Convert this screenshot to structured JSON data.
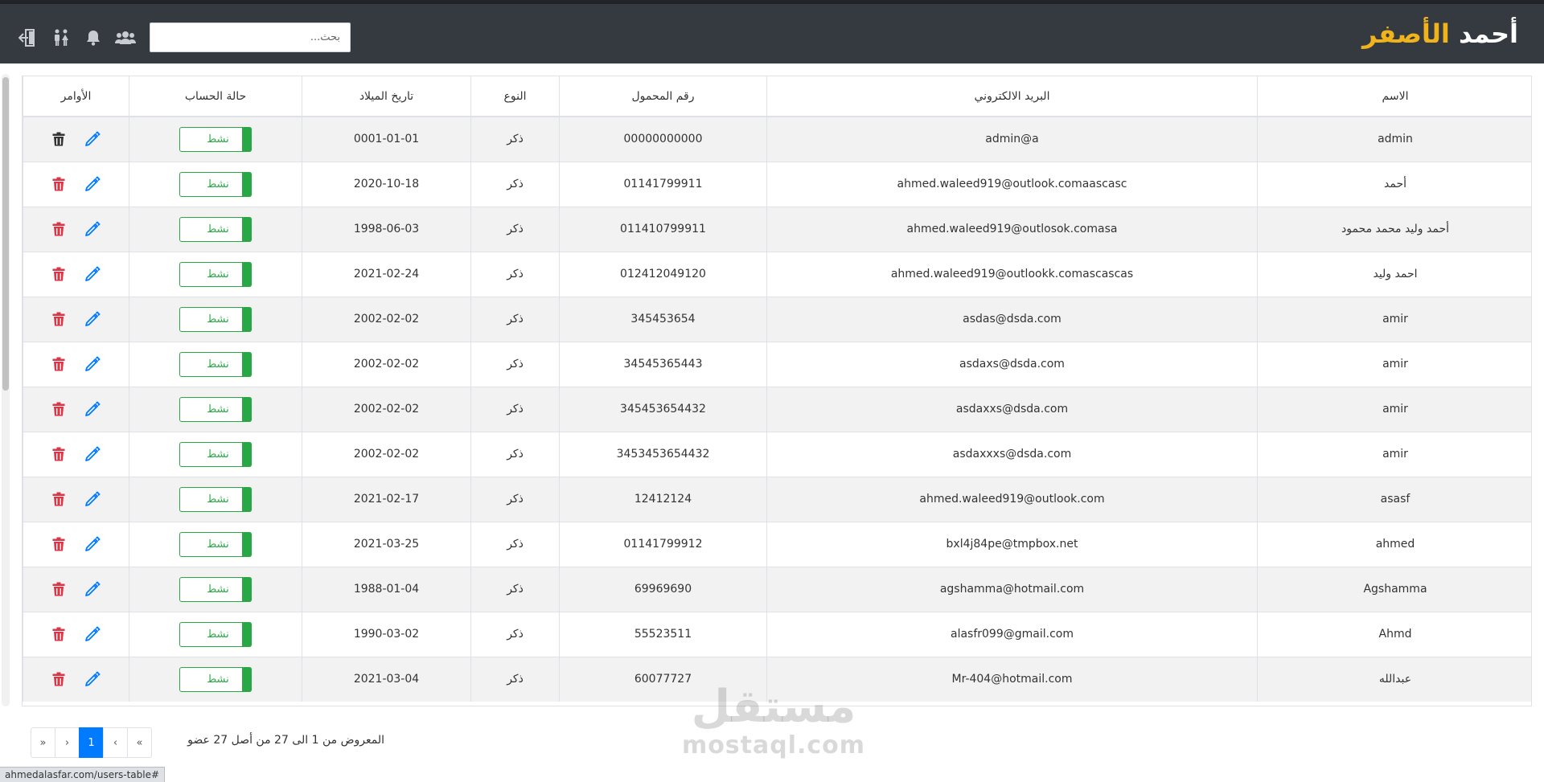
{
  "header": {
    "brand_first": "أحمد",
    "brand_second": "الأصفر",
    "search_placeholder": "بحث...",
    "icons": [
      "logout-icon",
      "gender-icon",
      "bell-icon",
      "users-icon"
    ],
    "colors": {
      "bar": "#343a40",
      "brand_accent": "#f0b31b"
    }
  },
  "table": {
    "columns": [
      "الاسم",
      "البريد الالكتروني",
      "رقم المحمول",
      "النوع",
      "تاريخ الميلاد",
      "حالة الحساب",
      "الأوامر"
    ],
    "rows": [
      {
        "name": "admin",
        "email": "admin@a",
        "mobile": "00000000000",
        "gender": "ذكر",
        "birth": "0001-01-01",
        "status": "نشط",
        "delete_color": "#333333"
      },
      {
        "name": "أحمد",
        "email": "ahmed.waleed919@outlook.comaascasc",
        "mobile": "01141799911",
        "gender": "ذكر",
        "birth": "2020-10-18",
        "status": "نشط",
        "delete_color": "#dc3545"
      },
      {
        "name": "أحمد وليد محمد محمود",
        "email": "ahmed.waleed919@outlosok.comasa",
        "mobile": "011410799911",
        "gender": "ذكر",
        "birth": "1998-06-03",
        "status": "نشط",
        "delete_color": "#dc3545"
      },
      {
        "name": "احمد وليد",
        "email": "ahmed.waleed919@outlookk.comascascas",
        "mobile": "012412049120",
        "gender": "ذكر",
        "birth": "2021-02-24",
        "status": "نشط",
        "delete_color": "#dc3545"
      },
      {
        "name": "amir",
        "email": "asdas@dsda.com",
        "mobile": "345453654",
        "gender": "ذكر",
        "birth": "2002-02-02",
        "status": "نشط",
        "delete_color": "#dc3545"
      },
      {
        "name": "amir",
        "email": "asdaxs@dsda.com",
        "mobile": "34545365443",
        "gender": "ذكر",
        "birth": "2002-02-02",
        "status": "نشط",
        "delete_color": "#dc3545"
      },
      {
        "name": "amir",
        "email": "asdaxxs@dsda.com",
        "mobile": "345453654432",
        "gender": "ذكر",
        "birth": "2002-02-02",
        "status": "نشط",
        "delete_color": "#dc3545"
      },
      {
        "name": "amir",
        "email": "asdaxxxs@dsda.com",
        "mobile": "3453453654432",
        "gender": "ذكر",
        "birth": "2002-02-02",
        "status": "نشط",
        "delete_color": "#dc3545"
      },
      {
        "name": "asasf",
        "email": "ahmed.waleed919@outlook.com",
        "mobile": "12412124",
        "gender": "ذكر",
        "birth": "2021-02-17",
        "status": "نشط",
        "delete_color": "#dc3545"
      },
      {
        "name": "ahmed",
        "email": "bxl4j84pe@tmpbox.net",
        "mobile": "01141799912",
        "gender": "ذكر",
        "birth": "2021-03-25",
        "status": "نشط",
        "delete_color": "#dc3545"
      },
      {
        "name": "Agshamma",
        "email": "agshamma@hotmail.com",
        "mobile": "69969690",
        "gender": "ذكر",
        "birth": "1988-01-04",
        "status": "نشط",
        "delete_color": "#dc3545"
      },
      {
        "name": "Ahmd",
        "email": "alasfr099@gmail.com",
        "mobile": "55523511",
        "gender": "ذكر",
        "birth": "1990-03-02",
        "status": "نشط",
        "delete_color": "#dc3545"
      },
      {
        "name": "عبدالله",
        "email": "Mr-404@hotmail.com",
        "mobile": "60077727",
        "gender": "ذكر",
        "birth": "2021-03-04",
        "status": "نشط",
        "delete_color": "#dc3545"
      }
    ],
    "colors": {
      "status_green": "#28a745",
      "edit_blue": "#007bff"
    }
  },
  "pagination": {
    "first": "«",
    "prev": "‹",
    "current": "1",
    "next": "›",
    "last": "»",
    "summary": "المعروض من 1 الى 27 من أصل 27 عضو",
    "active_color": "#007bff"
  },
  "watermark": {
    "arabic": "مستقل",
    "latin": "mostaql.com"
  },
  "status_bar": {
    "url": "ahmedalasfar.com/users-table#"
  }
}
